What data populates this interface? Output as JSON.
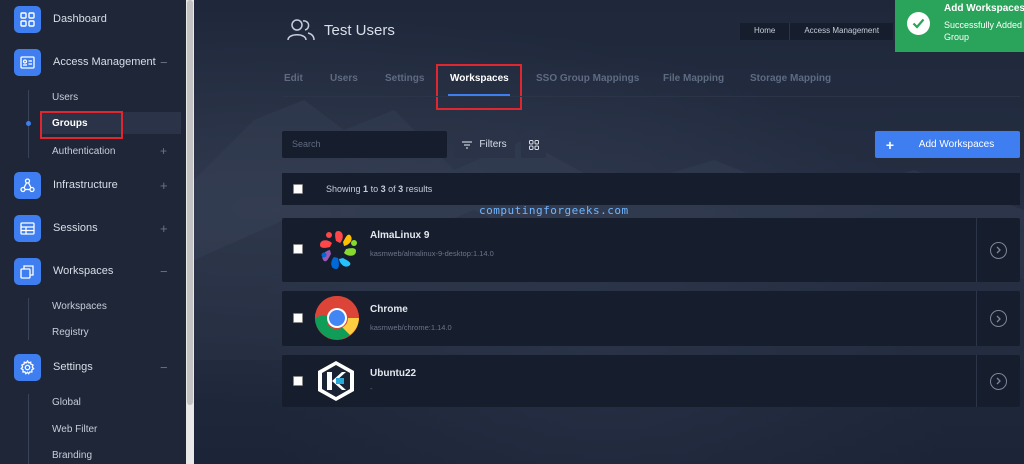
{
  "sidebar": {
    "items": [
      {
        "label": "Dashboard",
        "icon": "dashboard-icon",
        "expander": ""
      },
      {
        "label": "Access Management",
        "icon": "id-card-icon",
        "expander": "−"
      },
      {
        "label": "Infrastructure",
        "icon": "network-icon",
        "expander": "+"
      },
      {
        "label": "Sessions",
        "icon": "table-icon",
        "expander": "+"
      },
      {
        "label": "Workspaces",
        "icon": "windows-icon",
        "expander": "−"
      },
      {
        "label": "Settings",
        "icon": "gear-icon",
        "expander": "−"
      }
    ],
    "access_children": [
      {
        "label": "Users",
        "expander": ""
      },
      {
        "label": "Groups",
        "expander": "",
        "active": true
      },
      {
        "label": "Authentication",
        "expander": "+"
      }
    ],
    "workspaces_children": [
      {
        "label": "Workspaces"
      },
      {
        "label": "Registry"
      }
    ],
    "settings_children": [
      {
        "label": "Global"
      },
      {
        "label": "Web Filter"
      },
      {
        "label": "Branding"
      }
    ]
  },
  "header": {
    "title": "Test Users",
    "breadcrumbs": [
      "Home",
      "Access Management"
    ]
  },
  "tabs": [
    {
      "label": "Edit",
      "active": false
    },
    {
      "label": "Users",
      "active": false
    },
    {
      "label": "Settings",
      "active": false
    },
    {
      "label": "Workspaces",
      "active": true
    },
    {
      "label": "SSO Group Mappings",
      "active": false
    },
    {
      "label": "File Mapping",
      "active": false
    },
    {
      "label": "Storage Mapping",
      "active": false
    }
  ],
  "toolbar": {
    "search_placeholder": "Search",
    "filters_label": "Filters",
    "add_label": "Add Workspaces",
    "add_icon": "+"
  },
  "results": {
    "showing_prefix": "Showing",
    "from": "1",
    "to_word": "to",
    "to": "3",
    "of_word": "of",
    "total": "3",
    "suffix": "results"
  },
  "watermark": "computingforgeeks.com",
  "workspaces": [
    {
      "name": "AlmaLinux 9",
      "image": "kasmweb/almalinux-9-desktop:1.14.0",
      "logo": "almalinux-logo"
    },
    {
      "name": "Chrome",
      "image": "kasmweb/chrome:1.14.0",
      "logo": "chrome-logo"
    },
    {
      "name": "Ubuntu22",
      "image": "-",
      "logo": "kasm-logo"
    }
  ],
  "toast": {
    "title": "Add Workspaces",
    "message": "Successfully Added to Group"
  },
  "colors": {
    "accent": "#3f7ef0",
    "success": "#2aa45a",
    "highlight": "#e0262e"
  }
}
